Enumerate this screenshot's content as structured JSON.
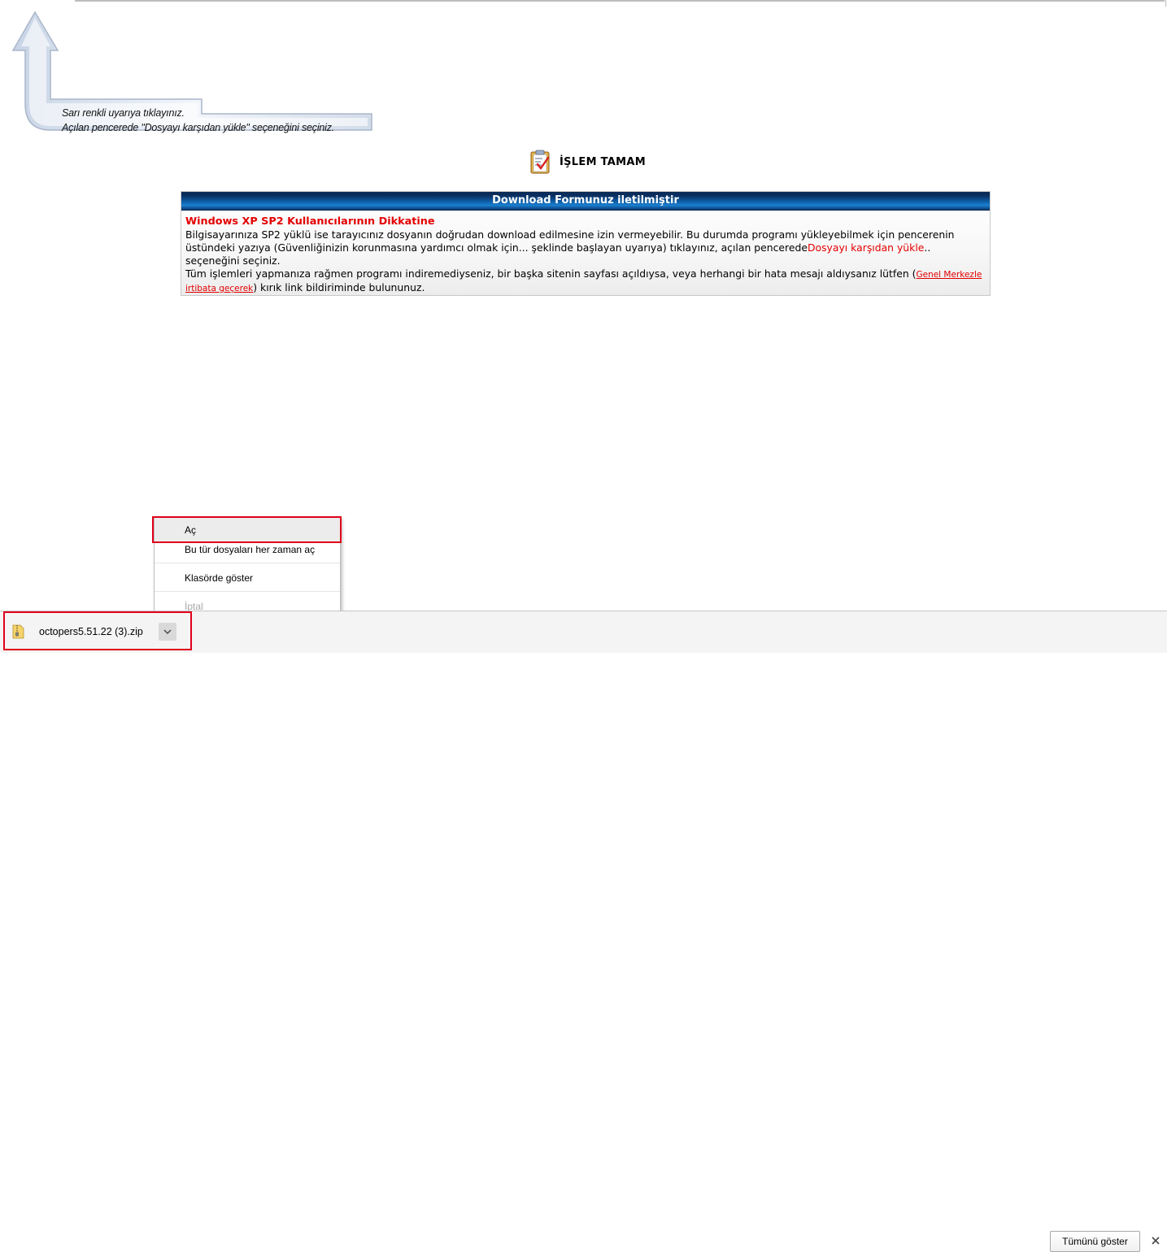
{
  "guide": {
    "line1": "Sarı renkli uyarıya tıklayınız.",
    "line2": "Açılan pencerede \"Dosyayı karşıdan yükle\" seçeneğini seçiniz."
  },
  "status": {
    "icon": "checklist-icon",
    "text": "İŞLEM TAMAM"
  },
  "panel": {
    "header": "Download Formunuz iletilmiştir",
    "warning_title": "Windows XP SP2 Kullanıcılarının Dikkatine",
    "p1_start": "Bilgisayarınıza SP2 yüklü ise tarayıcınız dosyanın doğrudan download edilmesine izin vermeyebilir. Bu durumda programı yükleyebilmek için pencerenin üstündeki yazıya (Güvenliğinizin korunmasına yardımcı olmak için... şeklinde başlayan uyarıya) tıklayınız, açılan pencerede",
    "p1_red": "Dosyayı karşıdan yükle",
    "p1_end": ".. seçeneğini seçiniz.",
    "p2_start": "Tüm işlemleri yapmanıza rağmen programı indiremediyseniz, bir başka sitenin sayfası açıldıysa, veya herhangi bir hata mesajı aldıysanız lütfen (",
    "p2_link": "Genel Merkezle irtibata geçerek",
    "p2_end": ") kırık link bildiriminde bulununuz."
  },
  "context_menu": {
    "items": [
      "Aç",
      "Bu tür dosyaları her zaman aç",
      "Klasörde göster",
      "İptal"
    ]
  },
  "download_bar": {
    "filename": "octopers5.51.22 (3).zip",
    "show_all": "Tümünü göster"
  },
  "colors": {
    "highlight": "#e0001b",
    "warning_red": "#e30000",
    "header_blue": "#0f5fa8"
  }
}
